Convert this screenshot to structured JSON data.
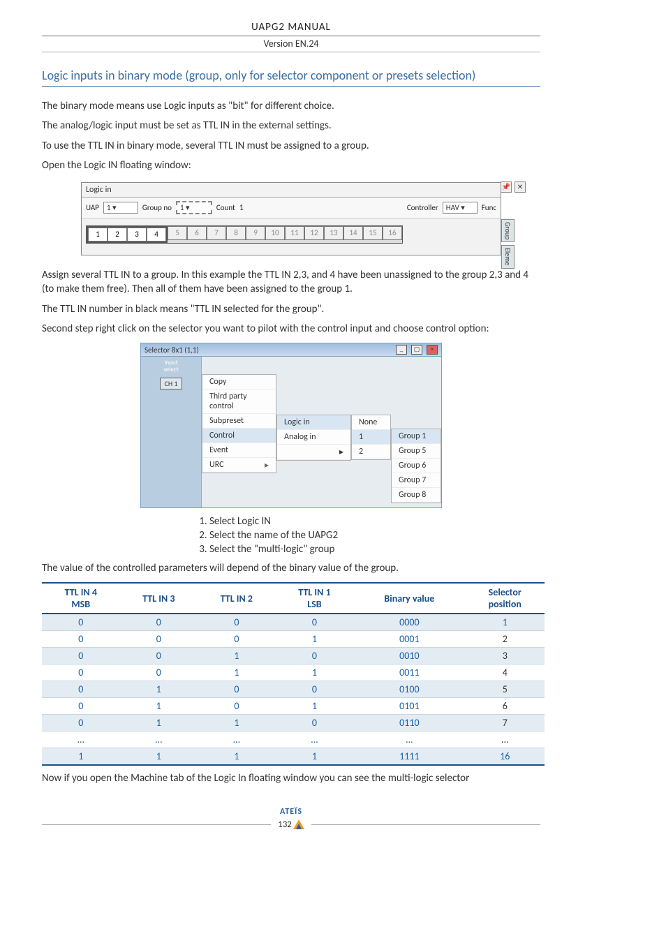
{
  "header": {
    "title": "UAPG2  MANUAL",
    "version": "Version EN.24"
  },
  "section": {
    "title": "Logic inputs in binary mode (group, only for selector component or presets selection)"
  },
  "para": {
    "p1": "The binary mode means use Logic inputs as \"bit\" for different choice.",
    "p2": "The analog/logic input must be set as TTL IN in the external settings.",
    "p3": " To use the TTL IN in binary mode, several TTL IN must be assigned to a group.",
    "p4": "Open the Logic IN floating window:",
    "p5": "Assign several TTL IN to a group. In this example the TTL IN 2,3, and 4 have been unassigned to the group 2,3 and 4 (to make them free). Then all of them have been assigned to the group 1.",
    "p6": "The TTL IN number in black means \"TTL IN selected for the group\".",
    "p7": "Second step right click on the selector you want to pilot with the control input and choose control option:",
    "p8": "The value of the controlled parameters will depend of the binary value of the group.",
    "p9": "Now if you open the Machine tab of the Logic In floating window you can see the multi-logic selector"
  },
  "logicwin": {
    "title": "Logic in",
    "uap_label": "UAP",
    "uap_val": "1",
    "group_label": "Group no",
    "group_val": "1",
    "count_label": "Count",
    "count_val": "1",
    "controller_label": "Controller",
    "controller_val": "HAV",
    "func_label": "Func",
    "channels": [
      "1",
      "2",
      "3",
      "4",
      "5",
      "6",
      "7",
      "8",
      "9",
      "10",
      "11",
      "12",
      "13",
      "14",
      "15",
      "16"
    ],
    "side_tabs": [
      "Group",
      "Eleme"
    ]
  },
  "ctxmenu": {
    "title": "Selector 8x1 (1,1)",
    "input_select": "Input\nselect",
    "ch": "CH 1",
    "col1": [
      "Copy",
      "Third party control",
      "Subpreset",
      "Control",
      "Event",
      "URC"
    ],
    "col2": [
      "Logic in",
      "Analog in",
      "▸"
    ],
    "col3": [
      "None",
      "1",
      "2"
    ],
    "col4": [
      "Group 1",
      "Group 5",
      "Group 6",
      "Group 7",
      "Group 8"
    ]
  },
  "steps": {
    "s1": "Select Logic IN",
    "s2": "Select the name of the UAPG2",
    "s3": "Select the \"multi-logic\" group"
  },
  "table": {
    "headers": {
      "h1a": "TTL IN 4",
      "h1b": "MSB",
      "h2": "TTL IN 3",
      "h3": "TTL IN 2",
      "h4a": "TTL IN 1",
      "h4b": "LSB",
      "h5": "Binary value",
      "h6a": "Selector",
      "h6b": "position"
    }
  },
  "chart_data": {
    "type": "table",
    "title": "Binary value to selector position mapping",
    "columns": [
      "TTL IN 4 (MSB)",
      "TTL IN 3",
      "TTL IN 2",
      "TTL IN 1 (LSB)",
      "Binary value",
      "Selector position"
    ],
    "rows": [
      [
        "0",
        "0",
        "0",
        "0",
        "0000",
        "1"
      ],
      [
        "0",
        "0",
        "0",
        "1",
        "0001",
        "2"
      ],
      [
        "0",
        "0",
        "1",
        "0",
        "0010",
        "3"
      ],
      [
        "0",
        "0",
        "1",
        "1",
        "0011",
        "4"
      ],
      [
        "0",
        "1",
        "0",
        "0",
        "0100",
        "5"
      ],
      [
        "0",
        "1",
        "0",
        "1",
        "0101",
        "6"
      ],
      [
        "0",
        "1",
        "1",
        "0",
        "0110",
        "7"
      ],
      [
        "…",
        "…",
        "…",
        "…",
        "…",
        "…"
      ],
      [
        "1",
        "1",
        "1",
        "1",
        "1111",
        "16"
      ]
    ]
  },
  "footer": {
    "brand": "ATEÏS",
    "page": "132"
  }
}
